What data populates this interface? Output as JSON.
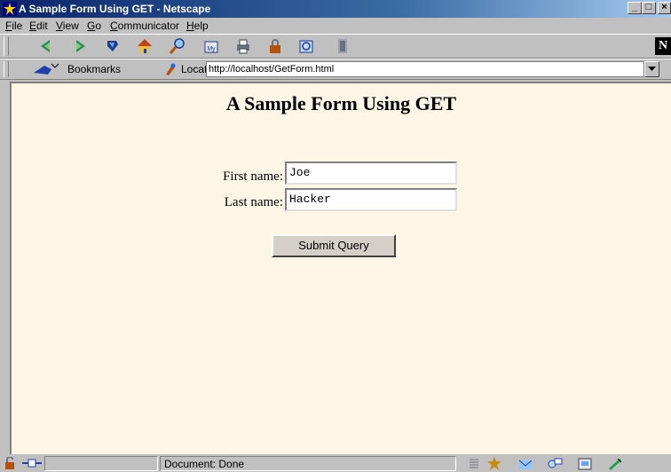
{
  "window": {
    "title": "A Sample Form Using GET - Netscape",
    "minimize_glyph": "_",
    "maximize_glyph": "□",
    "close_glyph": "×"
  },
  "menu": [
    {
      "key": "F",
      "rest": "ile"
    },
    {
      "key": "E",
      "rest": "dit"
    },
    {
      "key": "V",
      "rest": "iew"
    },
    {
      "key": "G",
      "rest": "o"
    },
    {
      "key": "C",
      "rest": "ommunicator"
    },
    {
      "key": "H",
      "rest": "elp"
    }
  ],
  "toolbar": {
    "icons": [
      "back-icon",
      "forward-icon",
      "reload-icon",
      "home-icon",
      "search-icon",
      "guide-icon",
      "print-icon",
      "security-icon",
      "shop-icon",
      "stop-icon"
    ],
    "logo": "N"
  },
  "location_bar": {
    "bookmarks_label": "Bookmarks",
    "location_label": "Location:",
    "url": "http://localhost/GetForm.html"
  },
  "page": {
    "heading": "A Sample Form Using GET",
    "first_name_label": "First name:",
    "first_name_value": "Joe",
    "last_name_label": "Last name:",
    "last_name_value": "Hacker",
    "submit_label": "Submit Query"
  },
  "status": {
    "text": "Document: Done"
  },
  "colors": {
    "page_background": "#fdf5e6",
    "title_bar": "#0a246a",
    "chrome": "#c0c0c0"
  }
}
